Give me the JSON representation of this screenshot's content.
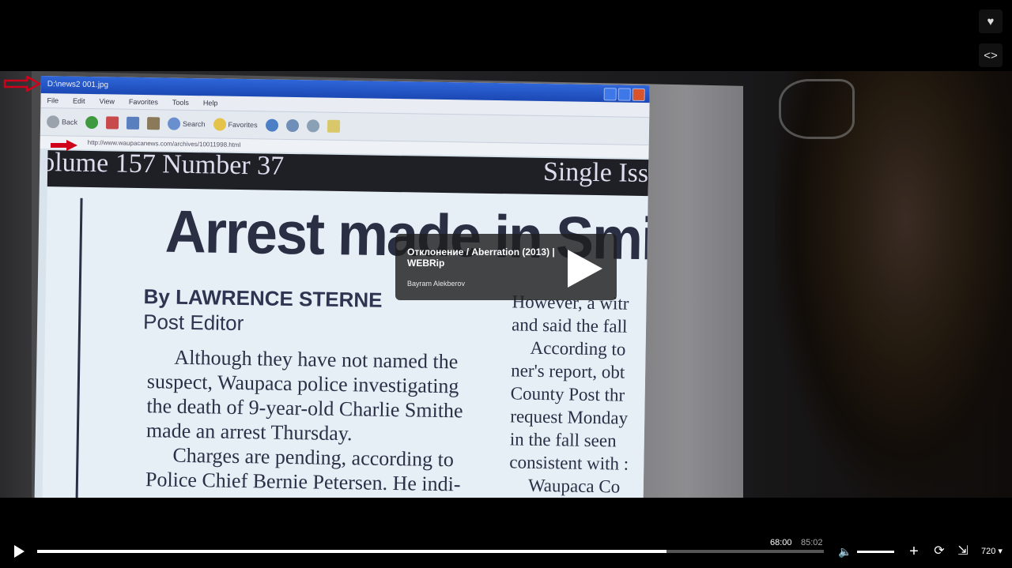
{
  "player": {
    "current_time": "68:00",
    "duration": "85:02",
    "progress_fraction": 0.8,
    "volume_fraction": 1.0,
    "quality": "720"
  },
  "video_card": {
    "title": "Отклонение / Aberration (2013) | WEBRip",
    "author": "Bayram Alekberov"
  },
  "screen_content": {
    "window_title": "D:\\news2 001.jpg",
    "menu": [
      "File",
      "Edit",
      "View",
      "Favorites",
      "Tools",
      "Help"
    ],
    "toolbar": [
      "Back",
      "Search",
      "Favorites"
    ],
    "address": "http://www.waupacanews.com/archives/10011998.html",
    "masthead_left": "olume 157 Number 37",
    "masthead_right": "Single Iss",
    "headline": "Arrest made in Smithe",
    "byline": "By LAWRENCE STERNE",
    "byrole": "Post Editor",
    "body_paragraphs": [
      "Although they have not named the suspect, Waupaca police investigating the death of 9-year-old Charlie Smithe made an arrest Thursday.",
      "Charges are pending, according to Police Chief Bernie Petersen. He indi-"
    ],
    "side_column": [
      "However, a witr",
      "and said the fall",
      "According to",
      "ner's report, obt",
      "County Post thr",
      "request Monday",
      "in the fall seen",
      "consistent with :",
      "Waupaca Co"
    ]
  },
  "colors": {
    "accent_arrow": "#d0021b",
    "player_background": "#000000"
  },
  "icons": {
    "top_right": [
      "heart-icon",
      "embed-code-icon"
    ],
    "controls": [
      "play-icon",
      "volume-icon",
      "add-icon",
      "loop-icon",
      "exit-fullscreen-icon"
    ]
  }
}
